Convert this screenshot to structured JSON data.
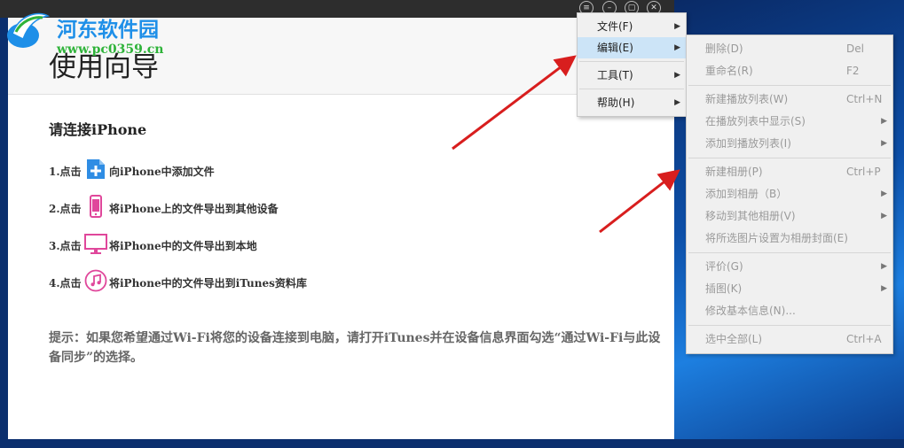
{
  "watermark": {
    "site_name": "河东软件园",
    "url": "www.pc0359.cn"
  },
  "guide": {
    "title": "使用向导",
    "connect_heading": "请连接iPhone",
    "steps": [
      {
        "prefix": "1.点击",
        "icon": "add-plus-icon",
        "text": "向iPhone中添加文件",
        "color": "#2f8de4"
      },
      {
        "prefix": "2.点击",
        "icon": "phone-icon",
        "text": "将iPhone上的文件导出到其他设备",
        "color": "#e0479b"
      },
      {
        "prefix": "3.点击",
        "icon": "monitor-icon",
        "text": "将iPhone中的文件导出到本地",
        "color": "#e0479b"
      },
      {
        "prefix": "4.点击",
        "icon": "music-note-icon",
        "text": "将iPhone中的文件导出到iTunes资料库",
        "color": "#e0479b"
      }
    ],
    "tip": "提示：如果您希望通过Wi-Fi将您的设备连接到电脑，请打开iTunes并在设备信息界面勾选“通过Wi-Fi与此设备同步”的选择。"
  },
  "main_menu": {
    "items": [
      {
        "label": "文件(F)"
      },
      {
        "label": "编辑(E)"
      },
      {
        "label": "工具(T)"
      },
      {
        "label": "帮助(H)"
      }
    ]
  },
  "edit_submenu": {
    "groups": [
      [
        {
          "label": "删除(D)",
          "shortcut": "Del"
        },
        {
          "label": "重命名(R)",
          "shortcut": "F2"
        }
      ],
      [
        {
          "label": "新建播放列表(W)",
          "shortcut": "Ctrl+N"
        },
        {
          "label": "在播放列表中显示(S)",
          "submenu": true
        },
        {
          "label": "添加到播放列表(I)",
          "submenu": true
        }
      ],
      [
        {
          "label": "新建相册(P)",
          "shortcut": "Ctrl+P"
        },
        {
          "label": "添加到相册（B）",
          "submenu": true
        },
        {
          "label": "移动到其他相册(V)",
          "submenu": true
        },
        {
          "label": "将所选图片设置为相册封面(E)"
        }
      ],
      [
        {
          "label": "评价(G)",
          "submenu": true
        },
        {
          "label": "插图(K)",
          "submenu": true
        },
        {
          "label": "修改基本信息(N)..."
        }
      ],
      [
        {
          "label": "选中全部(L)",
          "shortcut": "Ctrl+A"
        }
      ]
    ]
  },
  "colors": {
    "accent_blue": "#2f8de4",
    "icon_pink": "#e0479b",
    "annotation_red": "#d81e1e",
    "menu_highlight": "#cce4f7"
  }
}
